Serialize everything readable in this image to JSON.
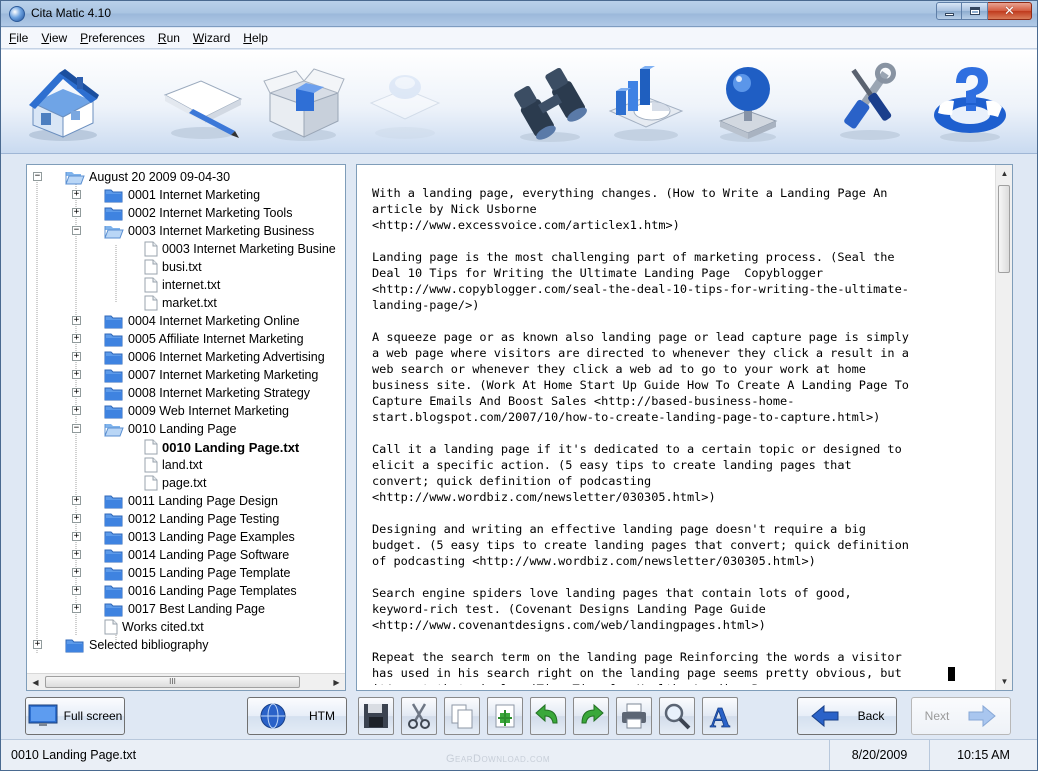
{
  "window": {
    "title": "Cita Matic 4.10"
  },
  "menu": [
    "File",
    "View",
    "Preferences",
    "Run",
    "Wizard",
    "Help"
  ],
  "toolbar_icons": [
    "home-icon",
    "note-pencil-icon",
    "open-box-icon",
    "faded-document-icon",
    "binoculars-icon",
    "chart-icon",
    "globe-icon",
    "tools-icon",
    "lifebuoy-help-icon"
  ],
  "tree": {
    "items": [
      {
        "label": "August 20 2009 09-04-30",
        "type": "folder-open",
        "expander": "−"
      },
      {
        "label": "0001 Internet Marketing",
        "type": "folder",
        "expander": "+"
      },
      {
        "label": "0002 Internet Marketing Tools",
        "type": "folder",
        "expander": "+"
      },
      {
        "label": "0003 Internet Marketing Business",
        "type": "folder-open",
        "expander": "−"
      },
      {
        "label": "0003 Internet Marketing Busine",
        "type": "file",
        "expander": ""
      },
      {
        "label": "busi.txt",
        "type": "file",
        "expander": ""
      },
      {
        "label": "internet.txt",
        "type": "file",
        "expander": ""
      },
      {
        "label": "market.txt",
        "type": "file",
        "expander": ""
      },
      {
        "label": "0004 Internet Marketing Online",
        "type": "folder",
        "expander": "+"
      },
      {
        "label": "0005 Affiliate Internet Marketing",
        "type": "folder",
        "expander": "+"
      },
      {
        "label": "0006 Internet Marketing Advertising",
        "type": "folder",
        "expander": "+"
      },
      {
        "label": "0007 Internet Marketing Marketing",
        "type": "folder",
        "expander": "+"
      },
      {
        "label": "0008 Internet Marketing Strategy",
        "type": "folder",
        "expander": "+"
      },
      {
        "label": "0009 Web Internet Marketing",
        "type": "folder",
        "expander": "+"
      },
      {
        "label": "0010 Landing Page",
        "type": "folder-open",
        "expander": "−"
      },
      {
        "label": "0010 Landing Page.txt",
        "type": "file",
        "expander": "",
        "selected": true
      },
      {
        "label": "land.txt",
        "type": "file",
        "expander": ""
      },
      {
        "label": "page.txt",
        "type": "file",
        "expander": ""
      },
      {
        "label": "0011 Landing Page Design",
        "type": "folder",
        "expander": "+"
      },
      {
        "label": "0012 Landing Page Testing",
        "type": "folder",
        "expander": "+"
      },
      {
        "label": "0013 Landing Page Examples",
        "type": "folder",
        "expander": "+"
      },
      {
        "label": "0014 Landing Page Software",
        "type": "folder",
        "expander": "+"
      },
      {
        "label": "0015 Landing Page Template",
        "type": "folder",
        "expander": "+"
      },
      {
        "label": "0016 Landing Page Templates",
        "type": "folder",
        "expander": "+"
      },
      {
        "label": "0017 Best Landing Page",
        "type": "folder",
        "expander": "+"
      },
      {
        "label": "Works cited.txt",
        "type": "file",
        "expander": ""
      },
      {
        "label": "Selected bibliography",
        "type": "folder",
        "expander": "+"
      }
    ],
    "scroll_thumb_glyph": "III"
  },
  "document": {
    "text": "With a landing page, everything changes. (How to Write a Landing Page An\narticle by Nick Usborne\n<http://www.excessvoice.com/articlex1.htm>)\n\nLanding page is the most challenging part of marketing process. (Seal the\nDeal 10 Tips for Writing the Ultimate Landing Page  Copyblogger\n<http://www.copyblogger.com/seal-the-deal-10-tips-for-writing-the-ultimate-\nlanding-page/>)\n\nA squeeze page or as known also landing page or lead capture page is simply\na web page where visitors are directed to whenever they click a result in a\nweb search or whenever they click a web ad to go to your work at home\nbusiness site. (Work At Home Start Up Guide How To Create A Landing Page To\nCapture Emails And Boost Sales <http://based-business-home-\nstart.blogspot.com/2007/10/how-to-create-landing-page-to-capture.html>)\n\nCall it a landing page if it's dedicated to a certain topic or designed to\nelicit a specific action. (5 easy tips to create landing pages that\nconvert; quick definition of podcasting\n<http://www.wordbiz.com/newsletter/030305.html>)\n\nDesigning and writing an effective landing page doesn't require a big\nbudget. (5 easy tips to create landing pages that convert; quick definition\nof podcasting <http://www.wordbiz.com/newsletter/030305.html>)\n\nSearch engine spiders love landing pages that contain lots of good,\nkeyword-rich test. (Covenant Designs Landing Page Guide\n<http://www.covenantdesigns.com/web/landingpages.html>)\n\nRepeat the search term on the landing page Reinforcing the words a visitor\nhas used in his search right on the landing page seems pretty obvious, but\nit's not that simple. (Time Time for Healthy Landing Pages"
  },
  "buttons": {
    "fullscreen": "Full screen",
    "htm": "HTM",
    "back": "Back",
    "next": "Next"
  },
  "status": {
    "file": "0010 Landing Page.txt",
    "date": "8/20/2009",
    "time": "10:15 AM"
  },
  "watermark": "GearDownload.com"
}
